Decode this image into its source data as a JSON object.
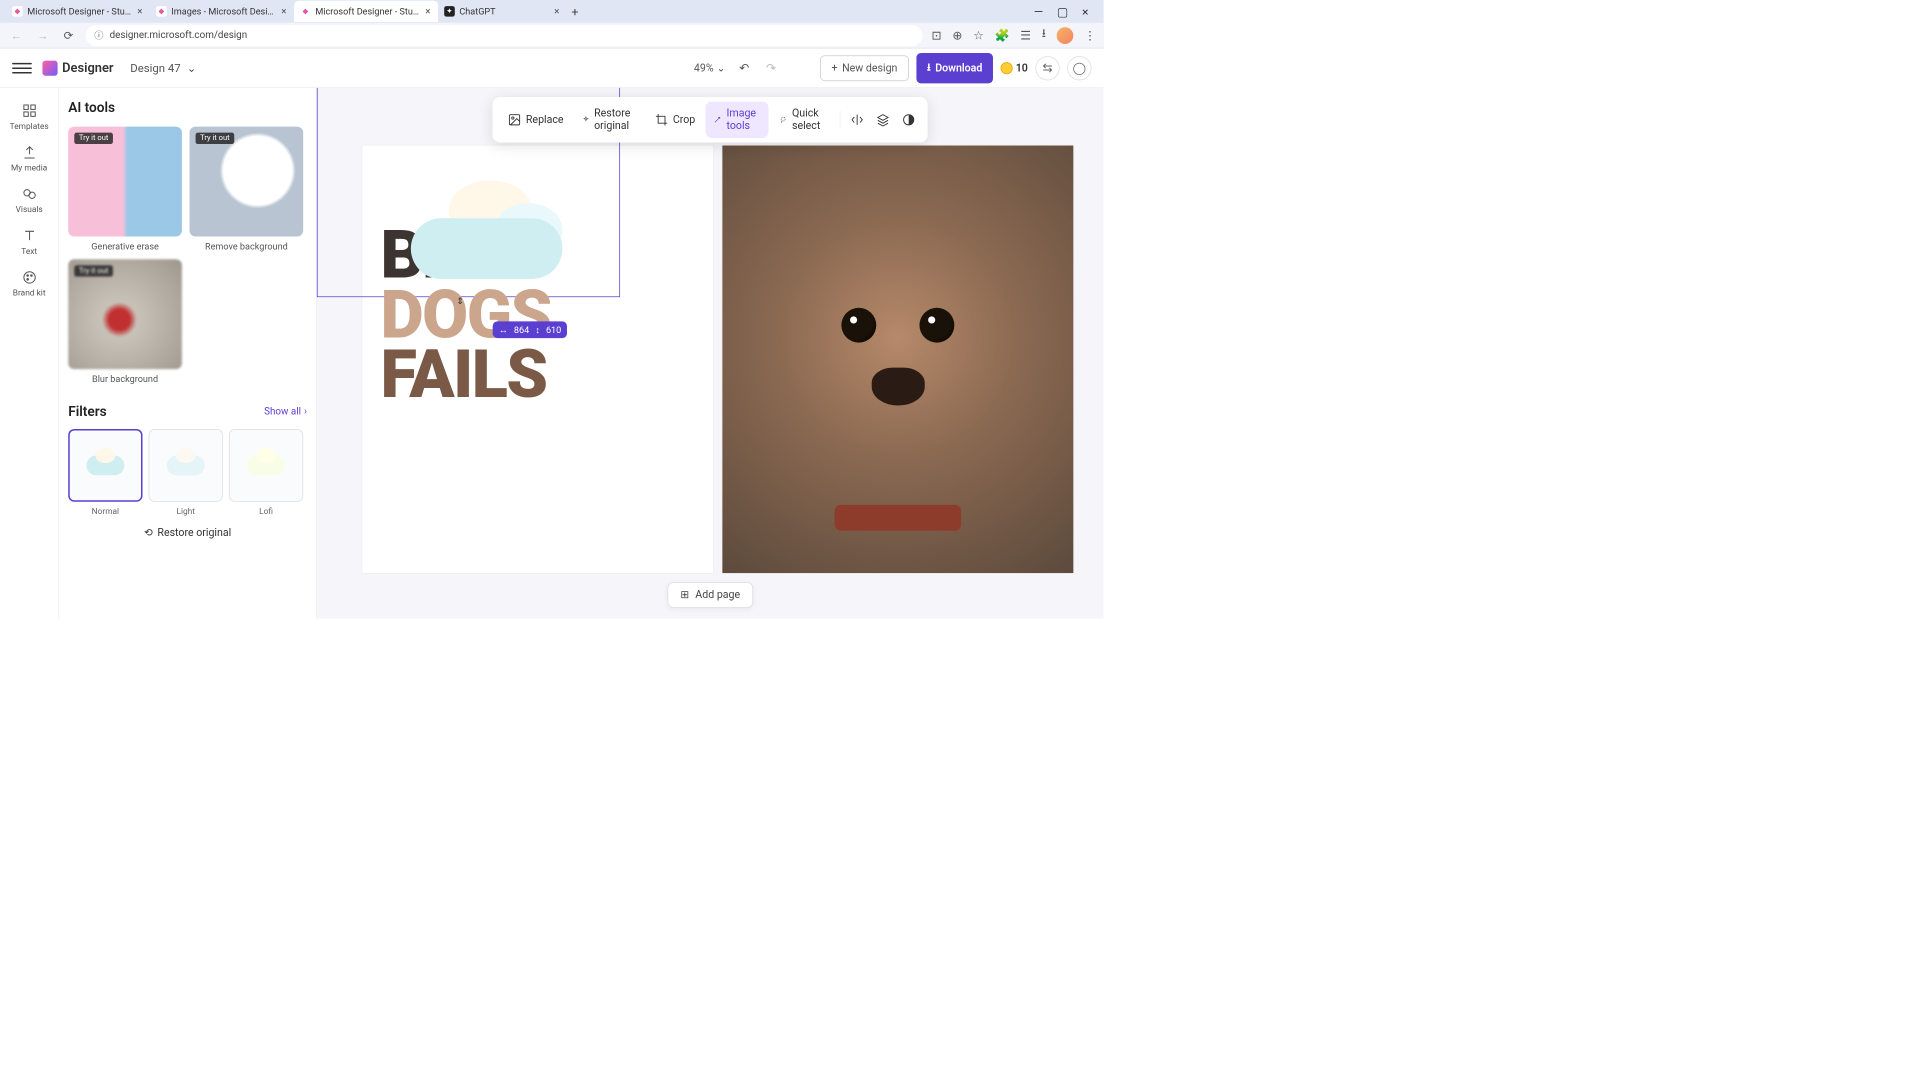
{
  "browser": {
    "tabs": [
      {
        "title": "Microsoft Designer - Stunning",
        "favicon_color": "#e557a6"
      },
      {
        "title": "Images - Microsoft Designer",
        "favicon_color": "#e557a6"
      },
      {
        "title": "Microsoft Designer - Stunning",
        "favicon_color": "#e557a6",
        "active": true
      },
      {
        "title": "ChatGPT",
        "favicon_color": "#222"
      }
    ],
    "url": "designer.microsoft.com/design"
  },
  "appbar": {
    "logo_text": "Designer",
    "doc_name": "Design 47",
    "zoom": "49%",
    "new_design_label": "New design",
    "download_label": "Download",
    "coin_count": "10"
  },
  "rail": {
    "items": [
      {
        "label": "Templates"
      },
      {
        "label": "My media"
      },
      {
        "label": "Visuals"
      },
      {
        "label": "Text"
      },
      {
        "label": "Brand kit"
      }
    ]
  },
  "side": {
    "ai_title": "AI tools",
    "try_badge": "Try it out",
    "tools": {
      "gen_erase": "Generative erase",
      "remove_bg": "Remove background",
      "blur_bg": "Blur background"
    },
    "filters_title": "Filters",
    "show_all": "Show all",
    "filters": {
      "normal": "Normal",
      "light": "Light",
      "lofi": "Lofi"
    },
    "restore_label": "Restore original"
  },
  "toolbar": {
    "replace": "Replace",
    "restore": "Restore original",
    "crop": "Crop",
    "image_tools": "Image tools",
    "quick_select": "Quick select"
  },
  "canvas": {
    "text1": "BEST",
    "text2": "DOGS",
    "text3": "FAILS",
    "sel_w": "864",
    "sel_h": "610"
  },
  "add_page_label": "Add page"
}
